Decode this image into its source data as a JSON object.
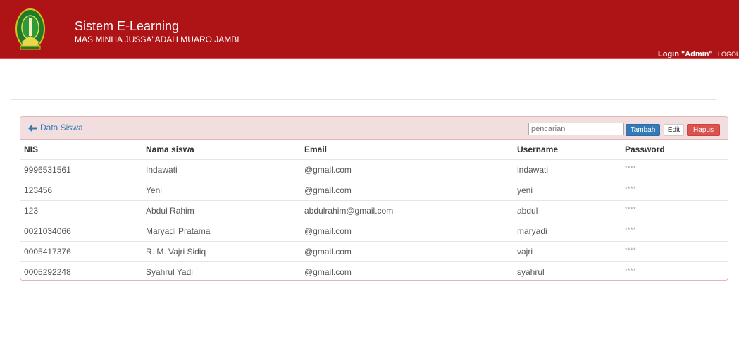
{
  "header": {
    "title": "Sistem E-Learning",
    "subtitle": "MAS MINHA JUSSA\"ADAH MUARO JAMBI",
    "login_text": "Login \"Admin\"",
    "logout_label": "LOGOUT",
    "colors": {
      "bar": "#ae1316",
      "accent": "#e04a4d"
    }
  },
  "panel": {
    "title": "Data Siswa",
    "search_placeholder": "pencarian",
    "buttons": {
      "add": "Tambah",
      "edit": "Edit",
      "delete": "Hapus"
    }
  },
  "table": {
    "columns": [
      "NIS",
      "Nama siswa",
      "Email",
      "Username",
      "Password"
    ],
    "rows": [
      [
        "9996531561",
        "Indawati",
        "@gmail.com",
        "indawati",
        "****"
      ],
      [
        "123456",
        "Yeni",
        "@gmail.com",
        "yeni",
        "****"
      ],
      [
        "123",
        "Abdul Rahim",
        "abdulrahim@gmail.com",
        "abdul",
        "****"
      ],
      [
        "0021034066",
        "Maryadi Pratama",
        "@gmail.com",
        "maryadi",
        "****"
      ],
      [
        "0005417376",
        "R. M. Vajri Sidiq",
        "@gmail.com",
        "vajri",
        "****"
      ],
      [
        "0005292248",
        "Syahrul Yadi",
        "@gmail.com",
        "syahrul",
        "****"
      ]
    ]
  }
}
